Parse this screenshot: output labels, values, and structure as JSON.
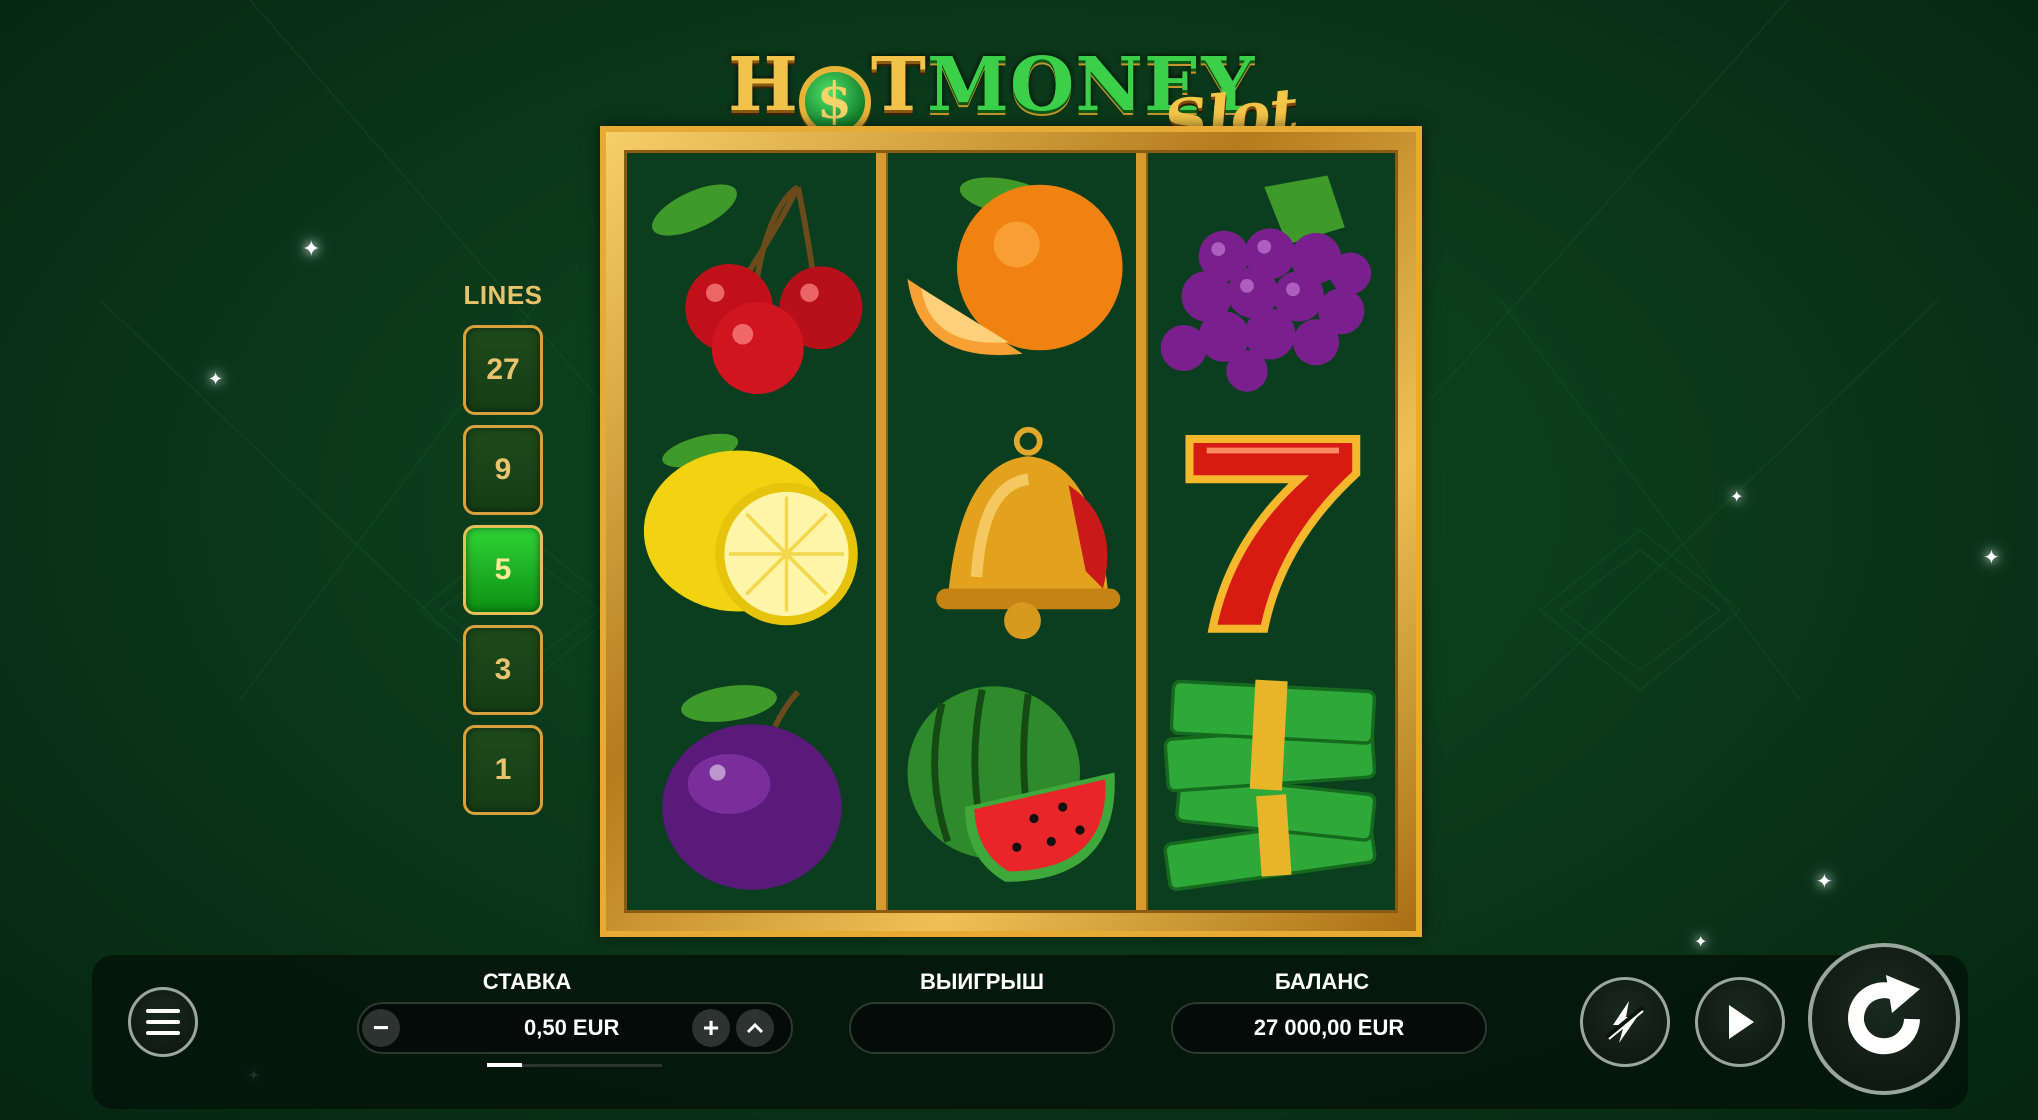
{
  "logo": {
    "part1": "H",
    "coin_symbol": "$",
    "part2": "T",
    "part3": "MONEY",
    "suffix": "Slot"
  },
  "reels": [
    [
      "cherries",
      "lemon",
      "plum"
    ],
    [
      "orange",
      "bell",
      "watermelon"
    ],
    [
      "grapes",
      "seven",
      "money-stack"
    ]
  ],
  "lines": {
    "title": "LINES",
    "options": [
      "27",
      "9",
      "5",
      "3",
      "1"
    ],
    "selected": "5"
  },
  "bottom_bar": {
    "bet_label": "СТАВКА",
    "bet_value": "0,50 EUR",
    "bet_minus": "−",
    "bet_plus": "+",
    "win_label": "ВЫИГРЫШ",
    "win_value": "",
    "balance_label": "БАЛАНС",
    "balance_value": "27 000,00 EUR",
    "bet_slider_fraction": 0.2
  },
  "icons": {
    "menu": "hamburger-menu-icon",
    "turbo": "lightning-icon",
    "autoplay": "play-icon",
    "spin": "refresh-arrow-icon"
  },
  "colors": {
    "gold": "#e6aa35",
    "active_green": "#1fbf28",
    "background": "#0b3a1b"
  }
}
